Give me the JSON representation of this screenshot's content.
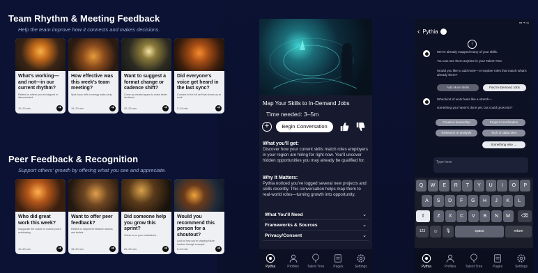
{
  "left": {
    "section1": {
      "title": "Team Rhythm & Meeting Feedback",
      "subtitle": "Help the team improve how it connects and makes decisions.",
      "cards": [
        {
          "title": "What's working—and not—in our current rhythm?",
          "desc": "Reflect on where you feel aligned or disconnected.",
          "time": "10–20 min"
        },
        {
          "title": "How effective was this week's team meeting?",
          "desc": "Spot focus drift or energy leaks early.",
          "time": "10–20 min"
        },
        {
          "title": "Want to suggest a format change or cadence shift?",
          "desc": "Come up created space to make better decisions.",
          "time": "20–30 min"
        },
        {
          "title": "Did everyone's voice get heard in the last sync?",
          "desc": "Connect to the full self that shows up at work.",
          "time": "5–10 min"
        }
      ]
    },
    "section2": {
      "title": "Peer Feedback & Recognition",
      "subtitle": "Support others' growth by offering what you see and appreciate.",
      "cards": [
        {
          "title": "Who did great work this week?",
          "desc": "Inaugurate the culture or culture you're celebrating.",
          "time": "10–20 min"
        },
        {
          "title": "Want to offer peer feedback?",
          "desc": "Reflect on alignment between actions and beliefs.",
          "time": "15–20 min"
        },
        {
          "title": "Did someone help you grow this sprint?",
          "desc": "Check in on your motivations.",
          "time": "20–30 min"
        },
        {
          "title": "Would you recommend this person for a shoutout?",
          "desc": "Look at how you're shaping future leaders through example.",
          "time": "5–10 min"
        }
      ]
    }
  },
  "mid": {
    "title": "Map Your Skills to In-Demand Jobs",
    "time": "Time needed: 3–5m",
    "begin_label": "Begin Conversation",
    "get_heading": "What you'll get:",
    "get_body": "Discover how your current skills match roles employers in your region are hiring for right now. You'll uncover hidden opportunities you may already be qualified for.",
    "why_heading": "Why It Matters:",
    "why_body": "Pythia noticed you've logged several new projects and skills recently. This conversation helps map them to real-world roles—turning growth into opportunity.",
    "accordion": [
      "What You'll Need",
      "Frameworks & Sources",
      "Privacy/Consent"
    ],
    "chevron": "⌄",
    "tabs": [
      "Pythia",
      "Profiles",
      "Talent Tree",
      "Pages",
      "Settings"
    ]
  },
  "right": {
    "status": "▪▪▪ ᯤ ▭",
    "back": "‹",
    "name": "Pythia",
    "up_arrow": "↑",
    "msg1a": "We've already mapped many of your skills.",
    "msg1b": "You can see them anytime in your Talent Tree.",
    "msg1c": "Would you like to add more—or explore roles that match what's already there?",
    "chip_add": "Add More Skills",
    "chip_find": "Find In-Demand Jobs",
    "msg2a": "What kind of work feels like a stretch—",
    "msg2b": "something you haven't done yet, but could grow into?",
    "chips": [
      "Creative leadership",
      "Project coordination",
      "Research or analysis",
      "Tech or data roles"
    ],
    "chip_else": "Something else →",
    "input_placeholder": "Type here",
    "kb_row1": [
      "Q",
      "W",
      "E",
      "R",
      "T",
      "Y",
      "U",
      "I",
      "O",
      "P"
    ],
    "kb_row2": [
      "A",
      "S",
      "D",
      "F",
      "G",
      "H",
      "J",
      "K",
      "L"
    ],
    "kb_row3": [
      "Z",
      "X",
      "C",
      "V",
      "B",
      "N",
      "M"
    ],
    "kb_shift": "⇧",
    "kb_back": "⌫",
    "kb_123": "123",
    "kb_space": "space",
    "kb_return": "return",
    "kb_emoji": "☺",
    "kb_mic": "🎙",
    "tabs": [
      "Pythia",
      "Profiles",
      "Talent Tree",
      "Pages",
      "Settings"
    ]
  },
  "colors": {
    "bg": "#0b1234",
    "card": "#eef0f4",
    "accent_teal": "#3fd3d0"
  }
}
